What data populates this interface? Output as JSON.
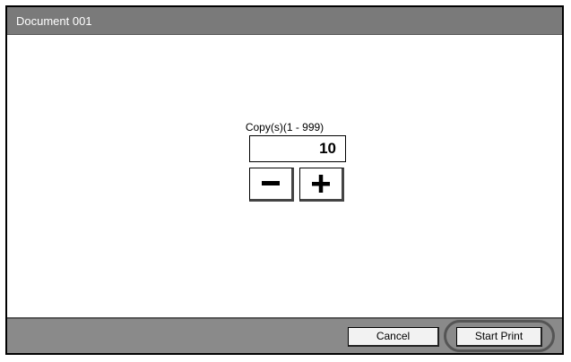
{
  "window": {
    "title": "Document 001"
  },
  "copies": {
    "label": "Copy(s)",
    "range": "(1 - 999)",
    "value": "10",
    "minus_symbol": "−",
    "plus_symbol": "+"
  },
  "footer": {
    "cancel_label": "Cancel",
    "start_label": "Start Print"
  },
  "icons": {
    "minus": "minus-icon",
    "plus": "plus-icon"
  },
  "colors": {
    "titlebar": "#7a7a7a",
    "footer": "#8a8a8a",
    "button_face": "#f2f2f2"
  }
}
